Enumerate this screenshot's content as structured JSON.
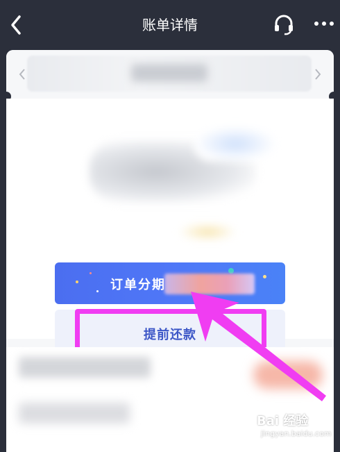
{
  "header": {
    "title": "账单详情"
  },
  "actions": {
    "installment_label": "订单分期",
    "repay_label": "提前还款"
  },
  "watermark": {
    "logo": "Bai 经验",
    "url": "jingyan.baidu.com"
  },
  "colors": {
    "header_bg": "#2b2f3b",
    "primary_blue": "#4f77f7",
    "highlight_magenta": "#f03df2"
  },
  "icons": [
    "back-icon",
    "headset-icon",
    "more-icon",
    "chevron-left-icon",
    "chevron-right-icon"
  ]
}
